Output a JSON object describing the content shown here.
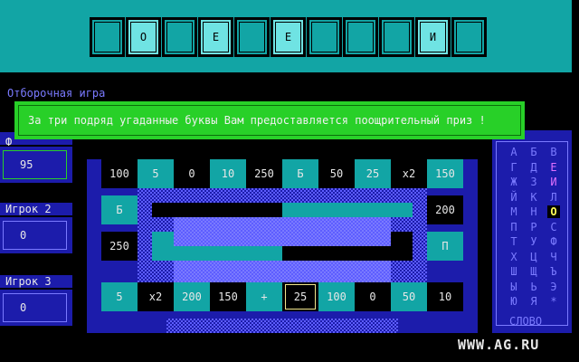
{
  "word_tiles": [
    "",
    "О",
    "",
    "Е",
    "",
    "Е",
    "",
    "",
    "",
    "И",
    ""
  ],
  "game_title": "Отборочная игра",
  "message": "За три подряд угаданные буквы Вам предоставляется поощрительный приз !",
  "players": [
    {
      "label": "Ф",
      "score": "95"
    },
    {
      "label": "Игрок 2",
      "score": "0"
    },
    {
      "label": "Игрок 3",
      "score": "0"
    }
  ],
  "board": {
    "top_row": [
      "100",
      "5",
      "0",
      "10",
      "250",
      "Б",
      "50",
      "25",
      "x2",
      "150"
    ],
    "bottom_row": [
      "5",
      "x2",
      "200",
      "150",
      "+",
      "25",
      "100",
      "0",
      "50",
      "10"
    ],
    "left_col": [
      "Б",
      "250"
    ],
    "right_col": [
      "200",
      "П"
    ],
    "selected_sector": "25"
  },
  "alphabet": {
    "letters": [
      [
        "А",
        "Б",
        "В"
      ],
      [
        "Г",
        "Д",
        "Е"
      ],
      [
        "Ж",
        "З",
        "И"
      ],
      [
        "Й",
        "К",
        "Л"
      ],
      [
        "М",
        "Н",
        "О"
      ],
      [
        "П",
        "Р",
        "С"
      ],
      [
        "Т",
        "У",
        "Ф"
      ],
      [
        "Х",
        "Ц",
        "Ч"
      ],
      [
        "Ш",
        "Щ",
        "Ъ"
      ],
      [
        "Ы",
        "Ь",
        "Э"
      ],
      [
        "Ю",
        "Я",
        "*"
      ]
    ],
    "used_letters": [
      "Е",
      "И"
    ],
    "cursor_letter": "О",
    "word_label": "СЛОВО"
  },
  "watermark": "WWW.AG.RU",
  "colors": {
    "teal": "#12a5a5",
    "light_teal": "#6fe3e3",
    "blue": "#1c1cab",
    "light_blue": "#7a7aff",
    "green": "#28d028"
  }
}
